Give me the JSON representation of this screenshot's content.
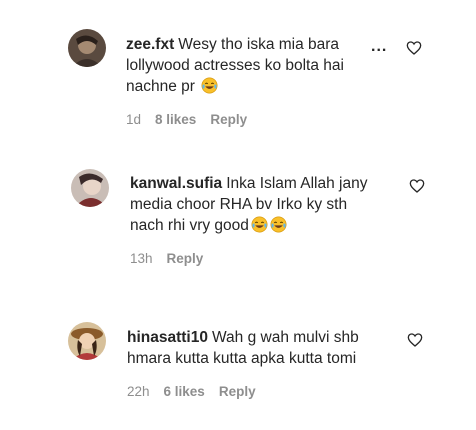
{
  "comments": [
    {
      "username": "zee.fxt",
      "line1": "Wesy tho iska mia bara",
      "line2": "lollywood actresses ko bolta hai",
      "line3": "nachne pr",
      "emojis": [
        "tears-of-joy-emoji"
      ],
      "time": "1d",
      "likes": "8 likes",
      "reply": "Reply",
      "has_more": true
    },
    {
      "username": "kanwal.sufia",
      "line1": "Inka Islam Allah jany",
      "line2": "media choor RHA bv Irko ky sth",
      "line3": "nach rhi vry good",
      "emojis": [
        "tears-of-joy-emoji",
        "tears-of-joy-emoji"
      ],
      "time": "13h",
      "likes": "",
      "reply": "Reply",
      "has_more": false
    },
    {
      "username": "hinasatti10",
      "line1": "Wah g wah mulvi shb",
      "line2": "hmara kutta kutta apka kutta tomi",
      "line3": "",
      "emojis": [],
      "time": "22h",
      "likes": "6 likes",
      "reply": "Reply",
      "has_more": false
    }
  ],
  "more_icon": "...",
  "icons": {
    "like": "heart-outline-icon",
    "more": "more-options-icon"
  },
  "colors": {
    "text": "#262626",
    "meta": "#8e8e8e"
  }
}
